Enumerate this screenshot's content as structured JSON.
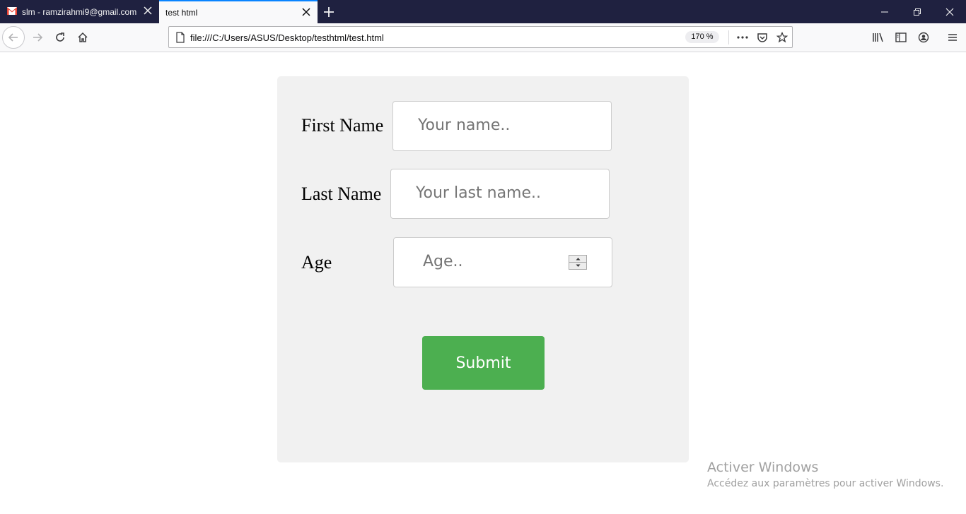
{
  "browser": {
    "tabs": [
      {
        "title": "slm - ramzirahmi9@gmail.com",
        "icon": "gmail-icon",
        "active": false
      },
      {
        "title": "test html",
        "active": true
      }
    ],
    "url": "file:///C:/Users/ASUS/Desktop/testhtml/test.html",
    "zoom": "170 %"
  },
  "form": {
    "first_name": {
      "label": "First Name",
      "placeholder": "Your name.."
    },
    "last_name": {
      "label": "Last Name",
      "placeholder": "Your last name.."
    },
    "age": {
      "label": "Age",
      "placeholder": "Age.."
    },
    "submit_label": "Submit"
  },
  "watermark": {
    "title": "Activer Windows",
    "subtitle": "Accédez aux paramètres pour activer Windows."
  },
  "colors": {
    "tabstrip": "#1f2140",
    "active_tab_accent": "#0a84ff",
    "submit_bg": "#4caf50",
    "panel_bg": "#f1f1f1"
  }
}
